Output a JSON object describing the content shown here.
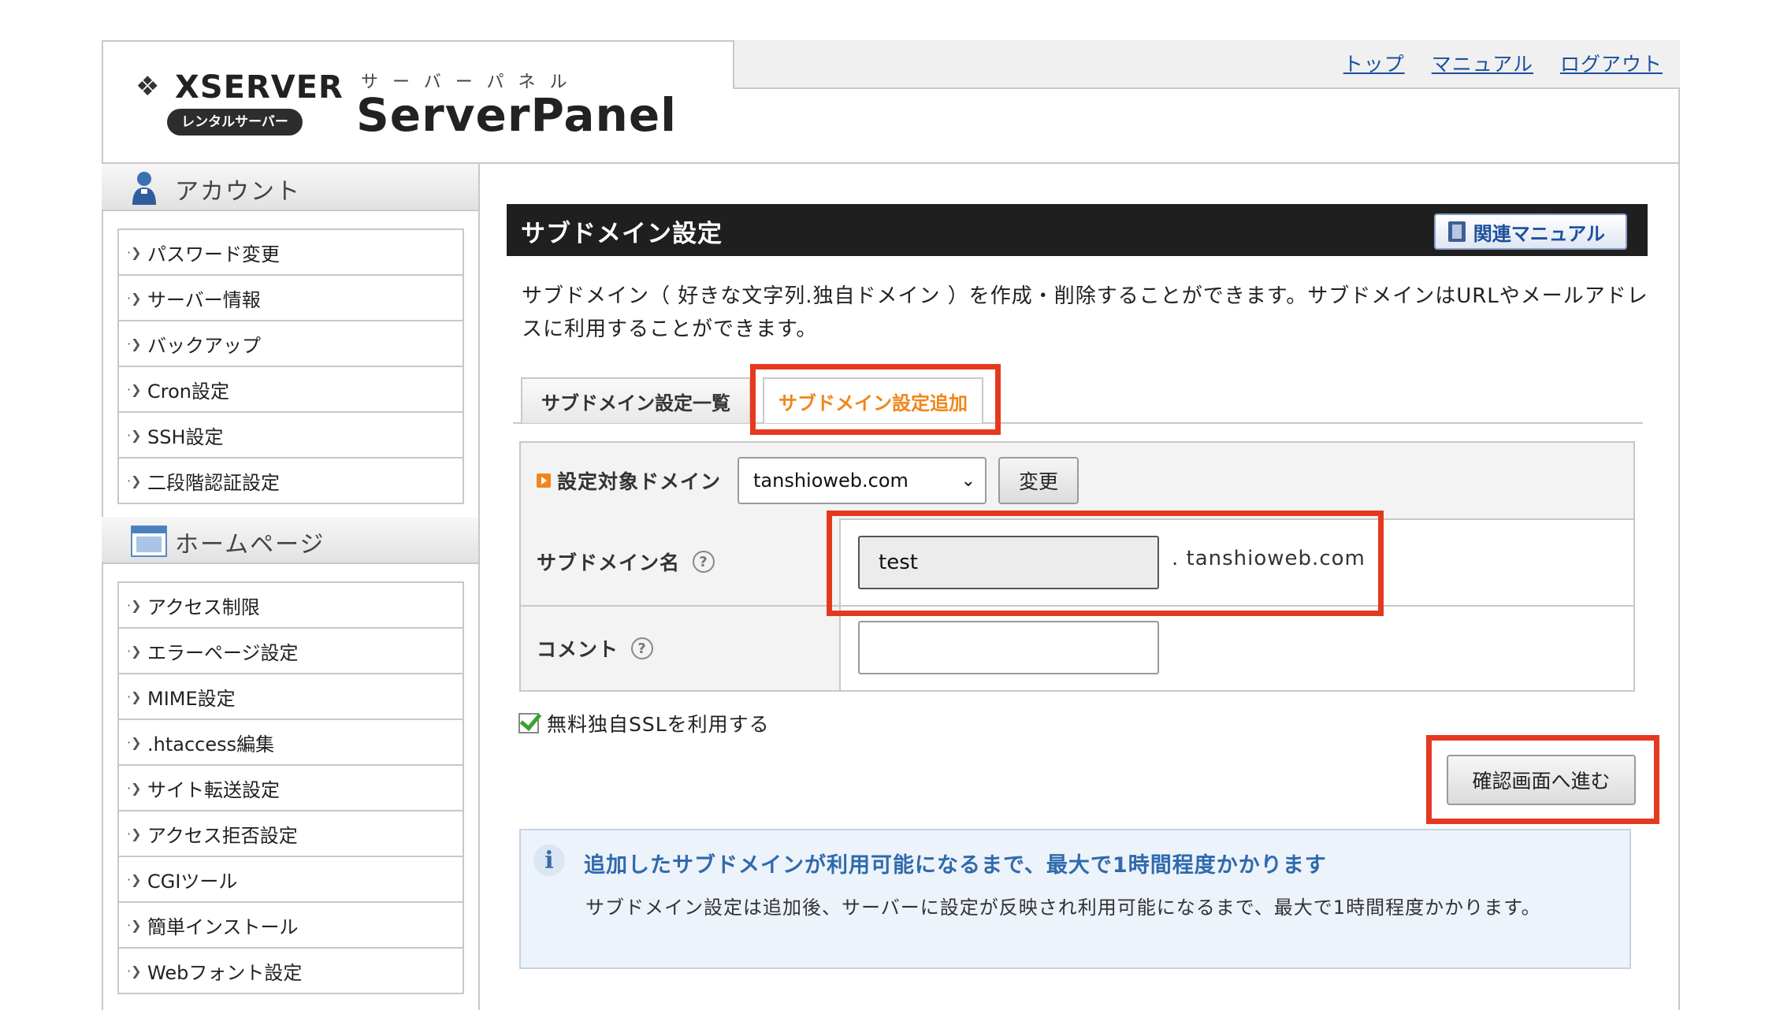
{
  "header": {
    "logo_text": "XSERVER",
    "logo_badge": "レンタルサーバー",
    "panel_sub": "サーバーパネル",
    "panel_title": "ServerPanel",
    "nav": [
      "トップ",
      "マニュアル",
      "ログアウト"
    ]
  },
  "sidebar": {
    "account_title": "アカウント",
    "account_items": [
      "パスワード変更",
      "サーバー情報",
      "バックアップ",
      "Cron設定",
      "SSH設定",
      "二段階認証設定"
    ],
    "homepage_title": "ホームページ",
    "homepage_items": [
      "アクセス制限",
      "エラーページ設定",
      "MIME設定",
      ".htaccess編集",
      "サイト転送設定",
      "アクセス拒否設定",
      "CGIツール",
      "簡単インストール",
      "Webフォント設定"
    ]
  },
  "main": {
    "title": "サブドメイン設定",
    "manual_button": "関連マニュアル",
    "description": "サブドメイン（ 好きな文字列.独自ドメイン ）を作成・削除することができます。サブドメインはURLやメールアドレスに利用することができます。",
    "tabs": [
      {
        "label": "サブドメイン設定一覧",
        "active": false
      },
      {
        "label": "サブドメイン設定追加",
        "active": true
      }
    ]
  },
  "form": {
    "domain_label": "設定対象ドメイン",
    "domain_value": "tanshioweb.com",
    "change_button": "変更",
    "subdomain_label": "サブドメイン名",
    "subdomain_value": "test",
    "subdomain_suffix": ". tanshioweb.com",
    "comment_label": "コメント",
    "comment_value": "",
    "help_glyph": "?",
    "ssl_label": "無料独自SSLを利用する",
    "ssl_checked": true,
    "confirm_button": "確認画面へ進む"
  },
  "info": {
    "icon_glyph": "i",
    "heading": "追加したサブドメインが利用可能になるまで、最大で1時間程度かかります",
    "body": "サブドメイン設定は追加後、サーバーに設定が反映され利用可能になるまで、最大で1時間程度かかります。"
  },
  "colors": {
    "accent_orange": "#f0861a",
    "highlight_red": "#e5391f",
    "link_blue": "#1b4f9c",
    "header_dark": "#1f1f1f"
  }
}
